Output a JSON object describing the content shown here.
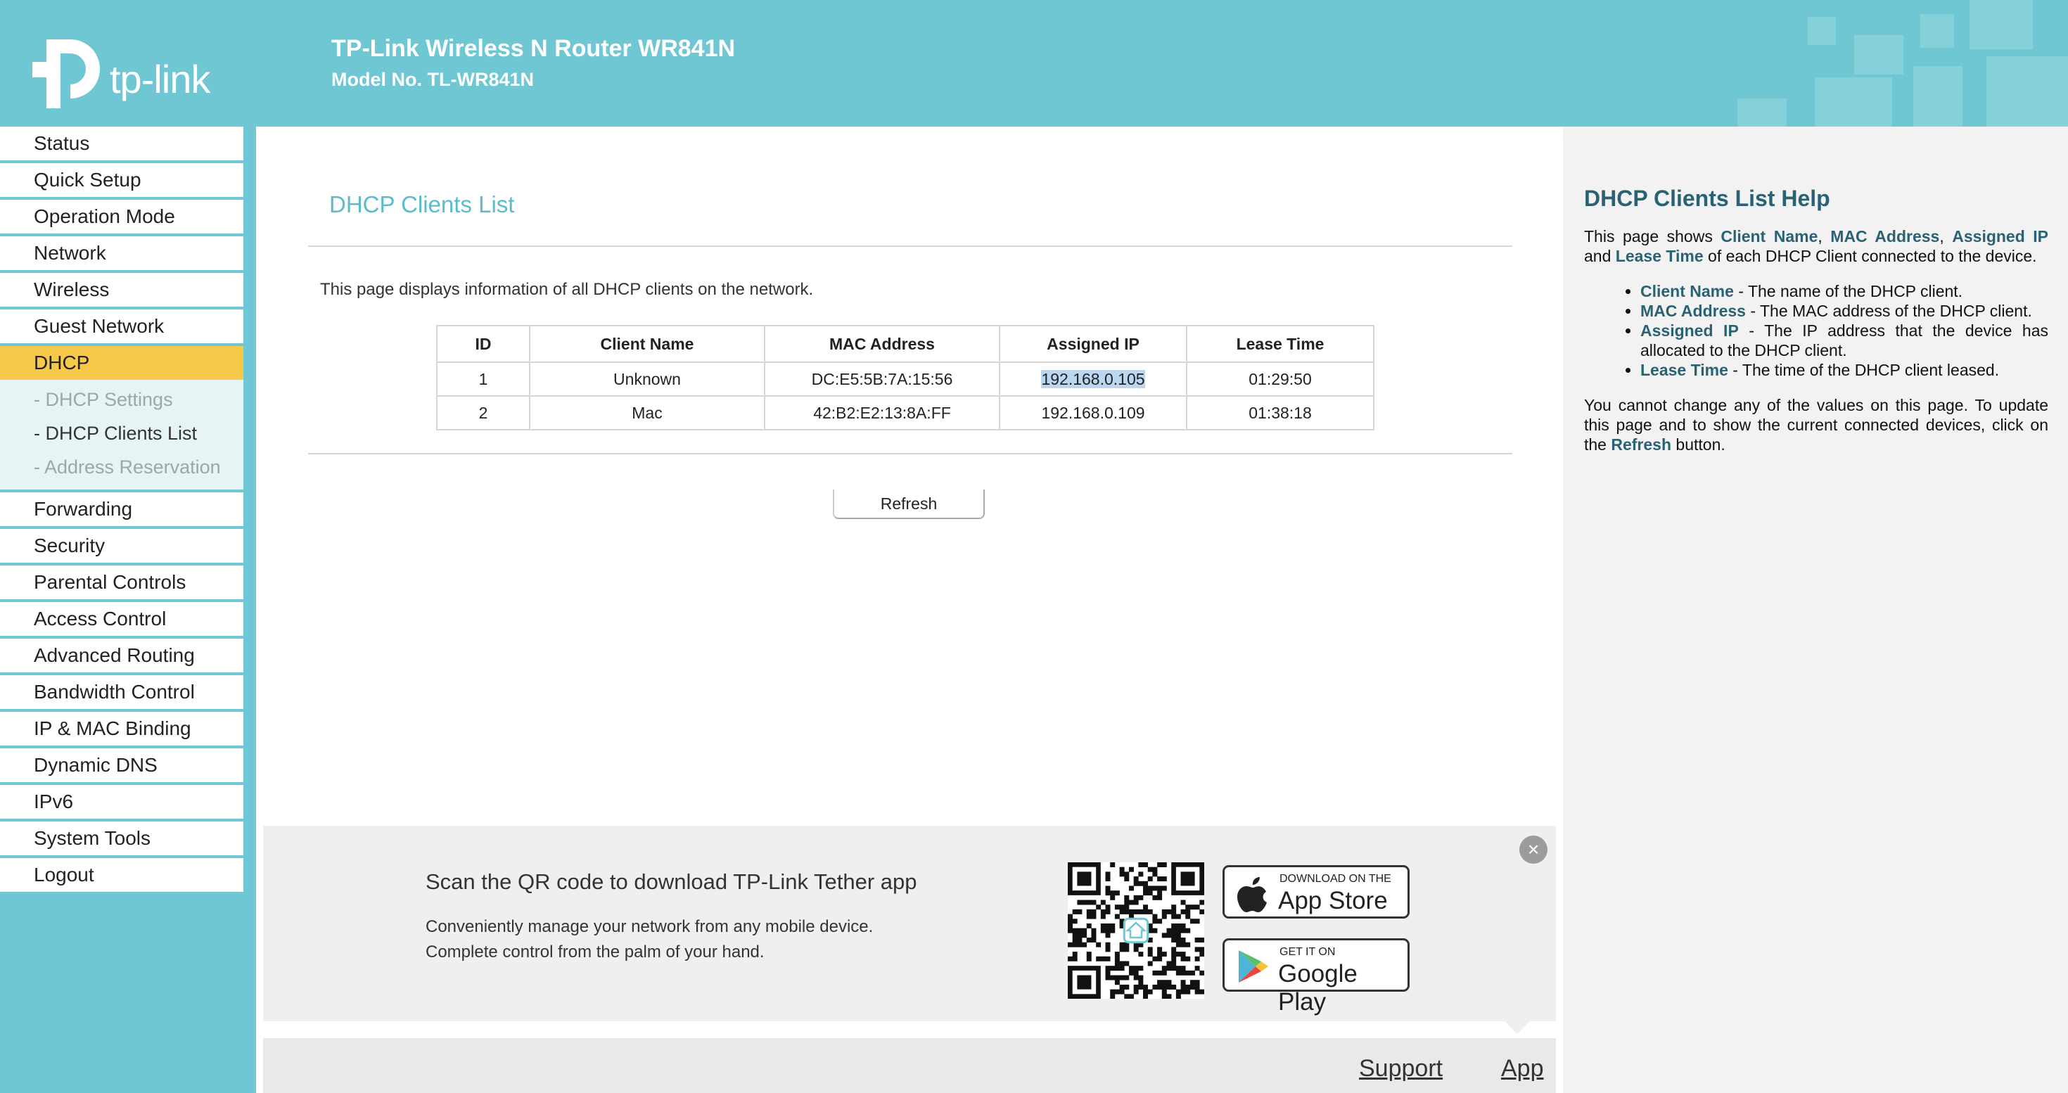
{
  "header": {
    "logo_text": "tp-link",
    "title": "TP-Link Wireless N Router WR841N",
    "model": "Model No. TL-WR841N"
  },
  "sidebar": {
    "items_top": [
      "Status",
      "Quick Setup",
      "Operation Mode",
      "Network",
      "Wireless",
      "Guest Network"
    ],
    "active": "DHCP",
    "subitems": [
      "- DHCP Settings",
      "- DHCP Clients List",
      "- Address Reservation"
    ],
    "items_bottom": [
      "Forwarding",
      "Security",
      "Parental Controls",
      "Access Control",
      "Advanced Routing",
      "Bandwidth Control",
      "IP & MAC Binding",
      "Dynamic DNS",
      "IPv6",
      "System Tools",
      "Logout"
    ]
  },
  "main": {
    "title": "DHCP Clients List",
    "description": "This page displays information of all DHCP clients on the network.",
    "table": {
      "headers": [
        "ID",
        "Client Name",
        "MAC Address",
        "Assigned IP",
        "Lease Time"
      ],
      "rows": [
        [
          "1",
          "Unknown",
          "DC:E5:5B:7A:15:56",
          "192.168.0.105",
          "01:29:50"
        ],
        [
          "2",
          "Mac",
          "42:B2:E2:13:8A:FF",
          "192.168.0.109",
          "01:38:18"
        ]
      ]
    },
    "refresh_label": "Refresh"
  },
  "promo": {
    "title": "Scan the QR code to download TP-Link Tether app",
    "line1": "Conveniently manage your network from any mobile device.",
    "line2": "Complete control from the palm of your hand.",
    "appstore_small": "DOWNLOAD ON THE",
    "appstore_big": "App Store",
    "googleplay_small": "GET IT ON",
    "googleplay_big": "Google Play",
    "close_glyph": "×"
  },
  "bottom": {
    "support": "Support",
    "app": "App"
  },
  "help": {
    "title": "DHCP Clients List Help",
    "intro_1": "This page shows ",
    "intro_b1": "Client Name",
    "intro_2": ", ",
    "intro_b2": "MAC Address",
    "intro_3": ", ",
    "intro_b3": "Assigned IP",
    "intro_4": " and ",
    "intro_b4": "Lease Time",
    "intro_5": " of each DHCP Client connected to the device.",
    "items": [
      {
        "term": "Client Name",
        "text": " - The name of the DHCP client."
      },
      {
        "term": "MAC Address",
        "text": " - The MAC address of the DHCP client."
      },
      {
        "term": "Assigned IP",
        "text": " - The IP address that the device has allocated to the DHCP client."
      },
      {
        "term": "Lease Time",
        "text": " - The time of the DHCP client leased."
      }
    ],
    "outro_1": "You cannot change any of the values on this page. To update this page and to show the current connected devices, click on the ",
    "outro_b": "Refresh",
    "outro_2": " button."
  },
  "colors": {
    "brand": "#6ec7d3",
    "active_nav": "#f7c948",
    "help_accent": "#2a6274"
  }
}
